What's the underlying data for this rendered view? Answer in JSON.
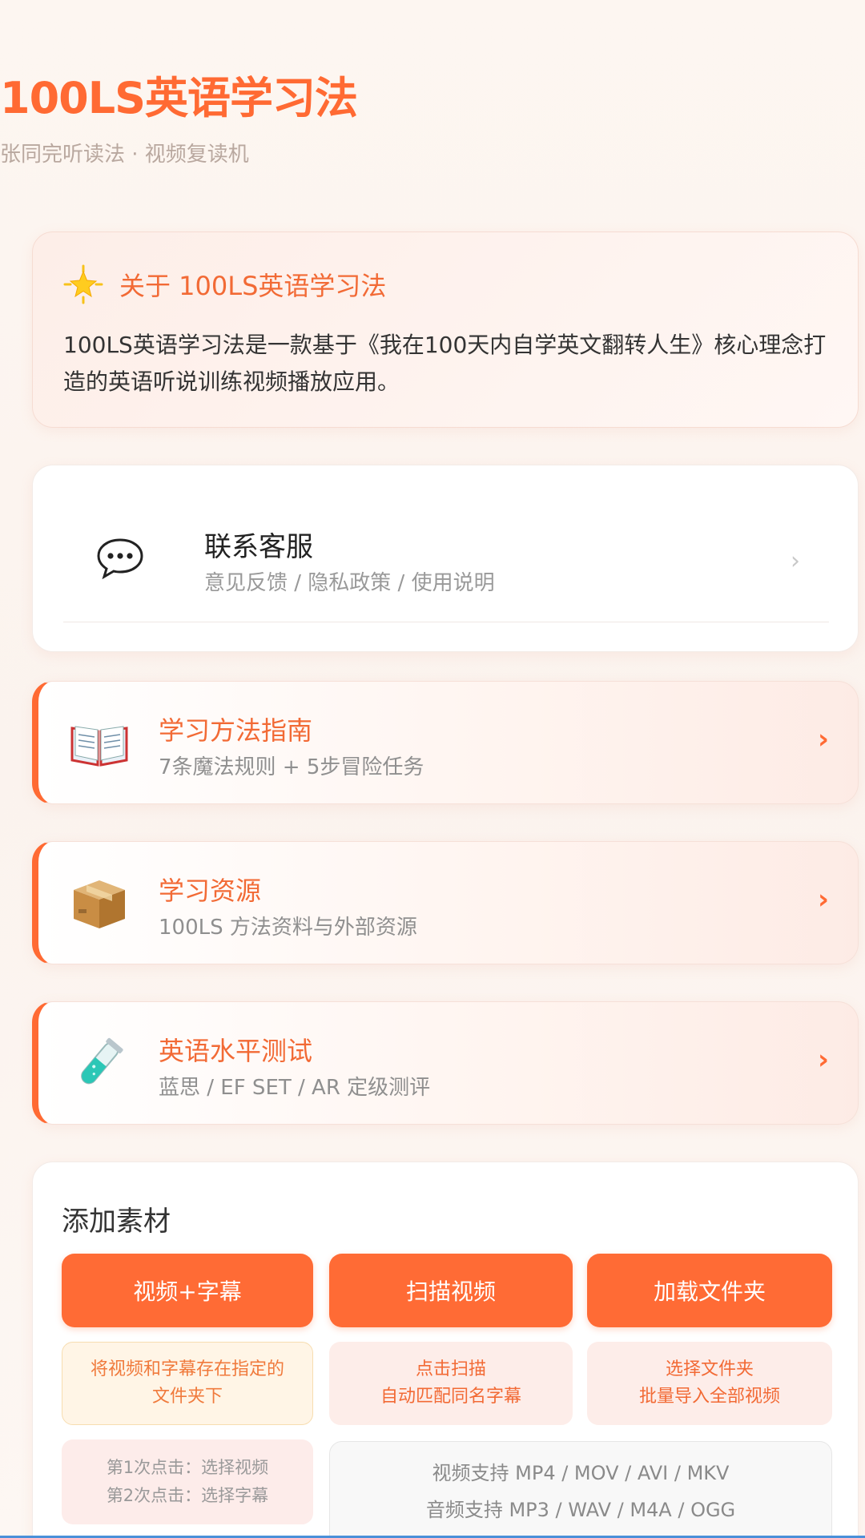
{
  "header": {
    "title": "100LS英语学习法",
    "subtitle": "张同完听读法 · 视频复读机"
  },
  "about": {
    "icon": "glowing-star-icon",
    "title": "关于 100LS英语学习法",
    "text": "100LS英语学习法是一款基于《我在100天内自学英文翻转人生》核心理念打造的英语听说训练视频播放应用。"
  },
  "contact": {
    "icon": "speech-bubble-icon",
    "title": "联系客服",
    "subtitle": "意见反馈 / 隐私政策 / 使用说明",
    "chevron": "›"
  },
  "menu": [
    {
      "icon": "open-book-icon",
      "title": "学习方法指南",
      "subtitle": "7条魔法规则 + 5步冒险任务",
      "chevron": "›"
    },
    {
      "icon": "package-box-icon",
      "title": "学习资源",
      "subtitle": "100LS 方法资料与外部资源",
      "chevron": "›"
    },
    {
      "icon": "test-tube-icon",
      "title": "英语水平测试",
      "subtitle": "蓝思 / EF SET / AR 定级测评",
      "chevron": "›"
    }
  ],
  "material": {
    "title": "添加素材",
    "buttons": [
      "视频+字幕",
      "扫描视频",
      "加载文件夹"
    ],
    "hints": [
      {
        "line1": "将视频和字幕存在指定的",
        "line2": "文件夹下"
      },
      {
        "line1": "点击扫描",
        "line2": "自动匹配同名字幕"
      },
      {
        "line1": "选择文件夹",
        "line2": "批量导入全部视频"
      }
    ],
    "steps": {
      "line1": "第1次点击：选择视频",
      "line2": "第2次点击：选择字幕"
    },
    "formats": {
      "video": "视频支持 MP4 / MOV / AVI / MKV",
      "audio": "音频支持 MP3 / WAV / M4A / OGG"
    }
  },
  "colors": {
    "accent": "#ff6b35",
    "background": "#fdf6f1"
  }
}
